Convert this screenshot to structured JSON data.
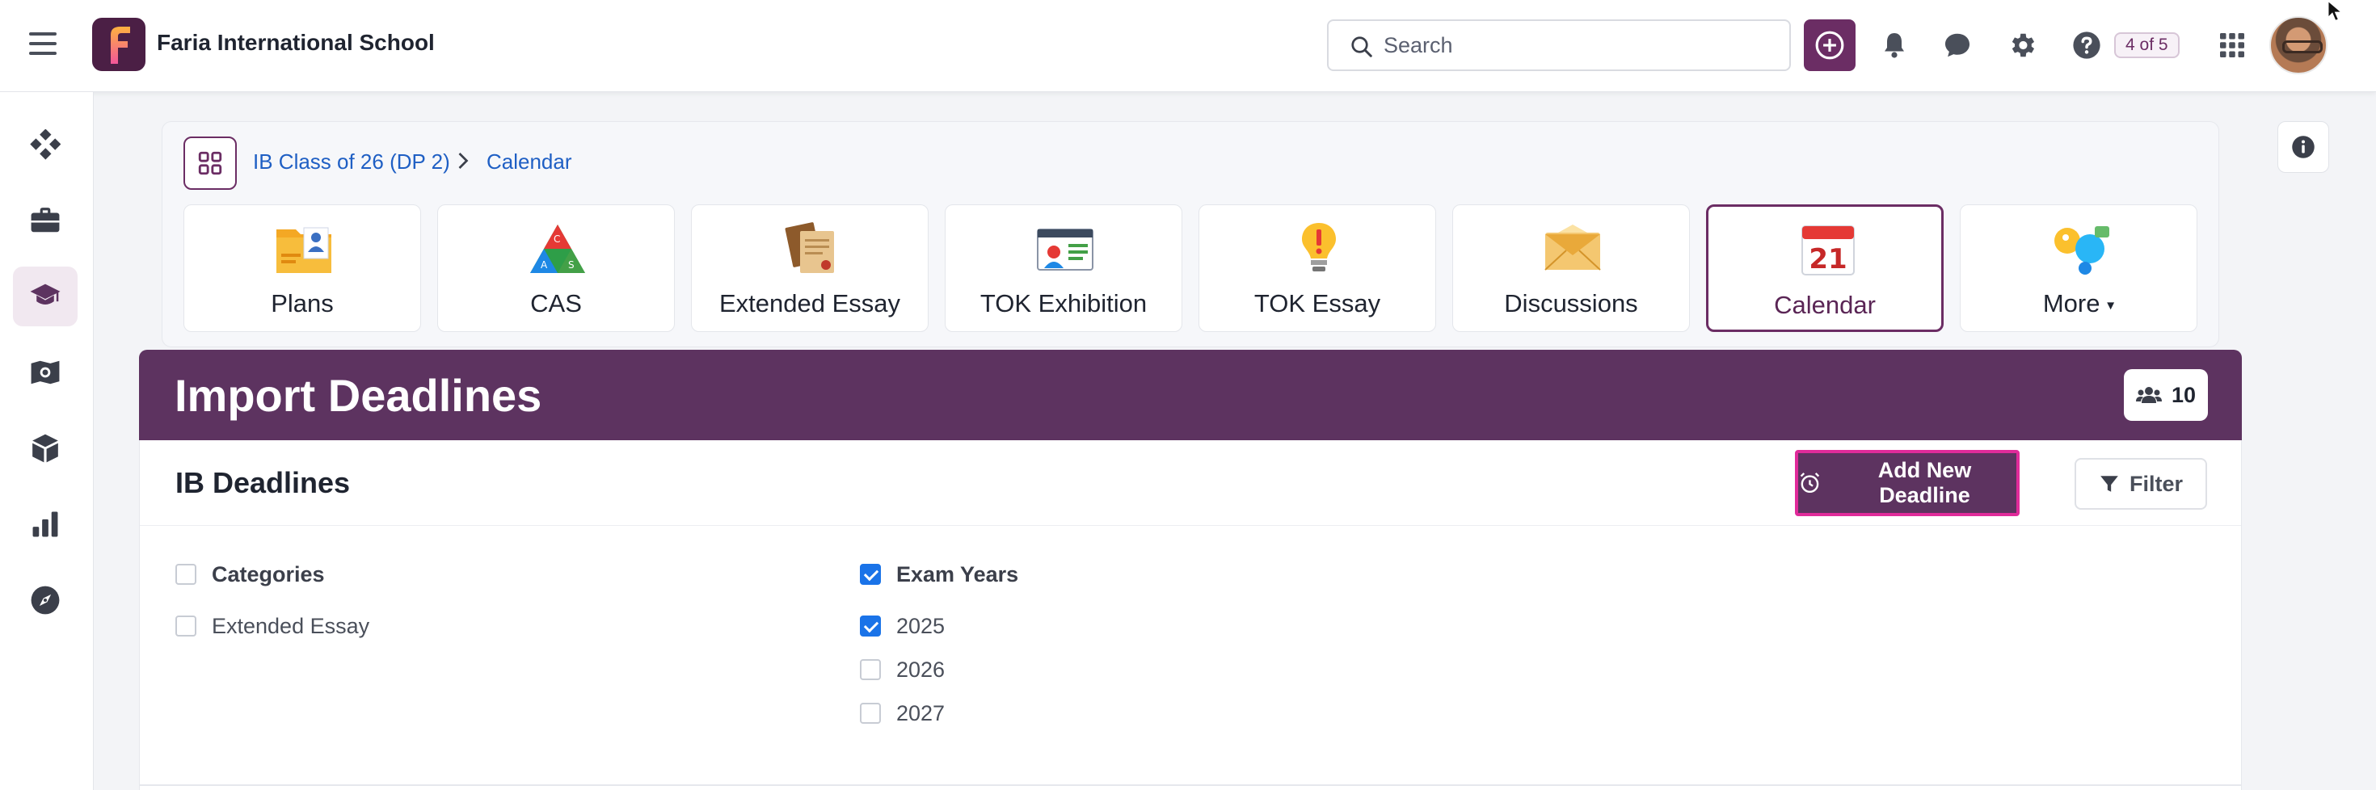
{
  "header": {
    "school_name": "Faria International School",
    "search_placeholder": "Search",
    "progress_badge": "4 of 5"
  },
  "breadcrumb": [
    "IB Class of 26 (DP 2)",
    "Calendar"
  ],
  "tiles": [
    {
      "label": "Plans",
      "icon": "plans-icon",
      "active": false
    },
    {
      "label": "CAS",
      "icon": "cas-icon",
      "active": false
    },
    {
      "label": "Extended Essay",
      "icon": "extended-essay-icon",
      "active": false
    },
    {
      "label": "TOK Exhibition",
      "icon": "tok-exhibition-icon",
      "active": false
    },
    {
      "label": "TOK Essay",
      "icon": "tok-essay-icon",
      "active": false
    },
    {
      "label": "Discussions",
      "icon": "discussions-icon",
      "active": false
    },
    {
      "label": "Calendar",
      "icon": "calendar-icon",
      "active": true,
      "calendar_day": "21"
    },
    {
      "label": "More",
      "icon": "more-icon",
      "active": false
    }
  ],
  "banner": {
    "title": "Import Deadlines",
    "people_count": "10"
  },
  "panel": {
    "title": "IB Deadlines",
    "add_button": "Add New Deadline",
    "filter_button": "Filter"
  },
  "categories": {
    "heading": "Categories",
    "checked": false,
    "items": [
      {
        "label": "Extended Essay",
        "checked": false
      }
    ]
  },
  "exam_years": {
    "heading": "Exam Years",
    "checked": true,
    "items": [
      {
        "label": "2025",
        "checked": true
      },
      {
        "label": "2026",
        "checked": false
      },
      {
        "label": "2027",
        "checked": false
      }
    ]
  },
  "colors": {
    "brand_purple": "#5d3360",
    "link_blue": "#1f5fc4",
    "highlight_pink": "#e02b9a",
    "checkbox_blue": "#1a73e8"
  }
}
